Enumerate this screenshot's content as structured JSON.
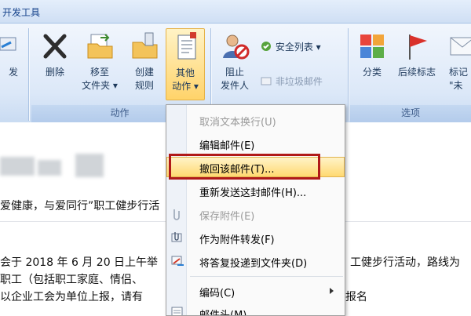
{
  "tab": {
    "label": "开发工具"
  },
  "groups": {
    "actions_label": "动作",
    "options_label": "选项"
  },
  "buttons": {
    "partial_left": "发",
    "delete": "删除",
    "move_to_folder": "移至\n文件夹 ▾",
    "create_rule": "创建\n规则",
    "other_actions": "其他\n动作 ▾",
    "block_sender": "阻止\n发件人",
    "safe_list": "安全列表 ▾",
    "not_junk": "非垃圾邮件",
    "categorize": "分类",
    "follow_up": "后续标志",
    "partial_right": "标记\n\"未"
  },
  "menu": {
    "items": [
      {
        "label": "取消文本换行(U)",
        "disabled": true
      },
      {
        "label": "编辑邮件(E)",
        "disabled": false
      },
      {
        "label": "撤回该邮件(T)...",
        "disabled": false,
        "highlighted": true
      },
      {
        "label": "重新发送这封邮件(H)...",
        "disabled": false
      },
      {
        "label": "保存附件(E)",
        "disabled": true
      },
      {
        "label": "作为附件转发(F)",
        "disabled": false
      },
      {
        "label": "将答复投递到文件夹(D)",
        "disabled": false
      },
      {
        "label": "编码(C)",
        "disabled": false,
        "submenu": true
      },
      {
        "label": "邮件头(M)",
        "disabled": false
      }
    ]
  },
  "body": {
    "subject_fragment": "爱健康，与爱同行”职工健步行活",
    "line1_left": "会于 2018 年 6 月 20 日上午举",
    "line1_right": "工健步行活动，路线为",
    "line2_left": "职工（包括职工家庭、情侣、",
    "line3_left": "以企业工会为单位上报，请有",
    "line3_right": "报名"
  },
  "colors": {
    "highlight_box": "#b01919",
    "hover_fill": "#ffd971"
  }
}
